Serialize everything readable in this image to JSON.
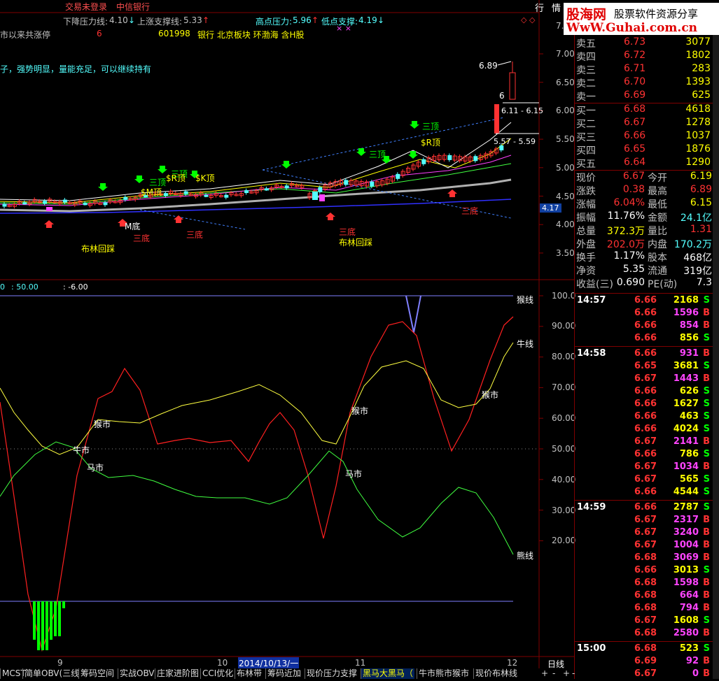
{
  "top_menu": {
    "login": "交易未登录",
    "broker": "中信银行",
    "menu_items": [
      "行",
      "情"
    ]
  },
  "info_line": {
    "down_pressure_label": "下降压力线:",
    "down_pressure_value": "4.10",
    "up_support_label": "上涨支撑线:",
    "up_support_value": "5.33",
    "high_pressure_label": "高点压力:",
    "high_pressure_value": "5.96",
    "low_support_label": "低点支撑:",
    "low_support_value": "4.19"
  },
  "stock_line": {
    "prefix": "市以来共涨停",
    "count": "6",
    "code": "601998",
    "sectors": "银行 北京板块 环渤海 含H股"
  },
  "comment": "子，强势明显，量能充足，可以继续持有",
  "logo": {
    "brand": "股海网",
    "slogan": "股票软件资源分享",
    "url": "WwW.Guhai.com.cn"
  },
  "price_axis": [
    "7.00",
    "6.50",
    "6.00",
    "5.50",
    "5.00",
    "4.50",
    "4.00",
    "3.50"
  ],
  "price_axis_top": "7.",
  "current_price_tag": "4.17",
  "candle_annotations": {
    "high": "6.89",
    "range1": "6.11 - 6.15",
    "range2": "5.57 - 5.59",
    "digit": "6",
    "top1": "三顶",
    "top2": "三顶",
    "top3": "三顶",
    "top4": "三顶",
    "rtop1": "$R顶",
    "rtop2": "$R顶",
    "ktop": "$K顶",
    "mtop": "$M顶",
    "bottom1": "三底",
    "bottom2": "三底",
    "bottom3": "三底",
    "bottom4": "三底",
    "mbottom": "M底",
    "boll1": "布林回踩",
    "boll2": "布林回踩"
  },
  "indicator_header": {
    "v1": "0",
    "v2": ": 50.00",
    "v3": ": -6.00"
  },
  "indicator_axis": [
    "100.0",
    "90.00",
    "80.00",
    "70.00",
    "60.00",
    "50.00",
    "40.00",
    "30.00",
    "20.00"
  ],
  "indicator_labels": {
    "monkey_line": "猴线",
    "bull_line": "牛线",
    "bear_line": "熊线",
    "monkey_market1": "猴市",
    "monkey_market2": "猴市",
    "monkey_market3": "猴市",
    "horse_market1": "马市",
    "horse_market2": "马市",
    "bull_market": "牛市"
  },
  "date_axis": {
    "d1": "9",
    "d2": "10",
    "d3": "2014/10/13/一",
    "d4": "11",
    "d5": "12",
    "period": "日线"
  },
  "bottom_tabs": [
    "MCST",
    "简单OBV(三线",
    "筹码空间",
    "实战OBV",
    "庄家进阶图",
    "CCI优化",
    "布林带",
    "筹码近加",
    "现价压力支撑",
    "黑马大黑马（",
    "牛市熊市猴市",
    "现价布林线"
  ],
  "active_tab_index": 9,
  "nav_buttons": [
    "+",
    "-",
    "+",
    "-"
  ],
  "order_book": {
    "asks": [
      {
        "label": "卖五",
        "price": "6.73",
        "vol": "3077"
      },
      {
        "label": "卖四",
        "price": "6.72",
        "vol": "1802"
      },
      {
        "label": "卖三",
        "price": "6.71",
        "vol": "283"
      },
      {
        "label": "卖二",
        "price": "6.70",
        "vol": "1393"
      },
      {
        "label": "卖一",
        "price": "6.69",
        "vol": "625"
      }
    ],
    "bids": [
      {
        "label": "买一",
        "price": "6.68",
        "vol": "4618"
      },
      {
        "label": "买二",
        "price": "6.67",
        "vol": "1278"
      },
      {
        "label": "买三",
        "price": "6.66",
        "vol": "1037"
      },
      {
        "label": "买四",
        "price": "6.65",
        "vol": "1876"
      },
      {
        "label": "买五",
        "price": "6.64",
        "vol": "1290"
      }
    ]
  },
  "quote": [
    {
      "l1": "现价",
      "v1": "6.67",
      "l2": "今开",
      "v2": "6.19"
    },
    {
      "l1": "涨跌",
      "v1": "0.38",
      "l2": "最高",
      "v2": "6.89"
    },
    {
      "l1": "涨幅",
      "v1": "6.04%",
      "l2": "最低",
      "v2": "6.15"
    },
    {
      "l1": "振幅",
      "v1": "11.76%",
      "l2": "金额",
      "v2": "24.1亿"
    },
    {
      "l1": "总量",
      "v1": "372.3万",
      "l2": "量比",
      "v2": "1.31"
    },
    {
      "l1": "外盘",
      "v1": "202.0万",
      "l2": "内盘",
      "v2": "170.2万"
    },
    {
      "l1": "换手",
      "v1": "1.17%",
      "l2": "股本",
      "v2": "468亿"
    },
    {
      "l1": "净资",
      "v1": "5.35",
      "l2": "流通",
      "v2": "319亿"
    },
    {
      "l1": "收益(三)",
      "v1": "0.690",
      "l2": "PE(动)",
      "v2": "7.3"
    }
  ],
  "ticks": [
    {
      "time": "14:57",
      "price": "6.66",
      "vol": "2168",
      "side": "S"
    },
    {
      "time": "",
      "price": "6.66",
      "vol": "1596",
      "side": "B"
    },
    {
      "time": "",
      "price": "6.66",
      "vol": "854",
      "side": "B"
    },
    {
      "time": "",
      "price": "6.66",
      "vol": "856",
      "side": "S"
    },
    {
      "time": "14:58",
      "price": "6.66",
      "vol": "931",
      "side": "B"
    },
    {
      "time": "",
      "price": "6.65",
      "vol": "3681",
      "side": "S"
    },
    {
      "time": "",
      "price": "6.67",
      "vol": "1443",
      "side": "B"
    },
    {
      "time": "",
      "price": "6.66",
      "vol": "626",
      "side": "S"
    },
    {
      "time": "",
      "price": "6.66",
      "vol": "1627",
      "side": "S"
    },
    {
      "time": "",
      "price": "6.66",
      "vol": "463",
      "side": "S"
    },
    {
      "time": "",
      "price": "6.66",
      "vol": "4024",
      "side": "S"
    },
    {
      "time": "",
      "price": "6.67",
      "vol": "2141",
      "side": "B"
    },
    {
      "time": "",
      "price": "6.66",
      "vol": "786",
      "side": "S"
    },
    {
      "time": "",
      "price": "6.67",
      "vol": "1034",
      "side": "B"
    },
    {
      "time": "",
      "price": "6.67",
      "vol": "565",
      "side": "S"
    },
    {
      "time": "",
      "price": "6.66",
      "vol": "4544",
      "side": "S"
    },
    {
      "time": "14:59",
      "price": "6.66",
      "vol": "2787",
      "side": "S"
    },
    {
      "time": "",
      "price": "6.67",
      "vol": "2317",
      "side": "B"
    },
    {
      "time": "",
      "price": "6.67",
      "vol": "3240",
      "side": "B"
    },
    {
      "time": "",
      "price": "6.67",
      "vol": "1004",
      "side": "B"
    },
    {
      "time": "",
      "price": "6.68",
      "vol": "3069",
      "side": "B"
    },
    {
      "time": "",
      "price": "6.66",
      "vol": "3013",
      "side": "S"
    },
    {
      "time": "",
      "price": "6.68",
      "vol": "1598",
      "side": "B"
    },
    {
      "time": "",
      "price": "6.68",
      "vol": "664",
      "side": "B"
    },
    {
      "time": "",
      "price": "6.68",
      "vol": "794",
      "side": "B"
    },
    {
      "time": "",
      "price": "6.67",
      "vol": "1608",
      "side": "S"
    },
    {
      "time": "",
      "price": "6.68",
      "vol": "2580",
      "side": "B"
    },
    {
      "time": "15:00",
      "price": "6.68",
      "vol": "523",
      "side": "S"
    },
    {
      "time": "",
      "price": "6.69",
      "vol": "92",
      "side": "B"
    },
    {
      "time": "",
      "price": "6.67",
      "vol": "0",
      "side": "B"
    }
  ],
  "colors": {
    "up": "#ff3232",
    "down": "#54ffff",
    "yellow": "#ffff00",
    "text": "#c0c0c0",
    "grid": "#800000"
  }
}
